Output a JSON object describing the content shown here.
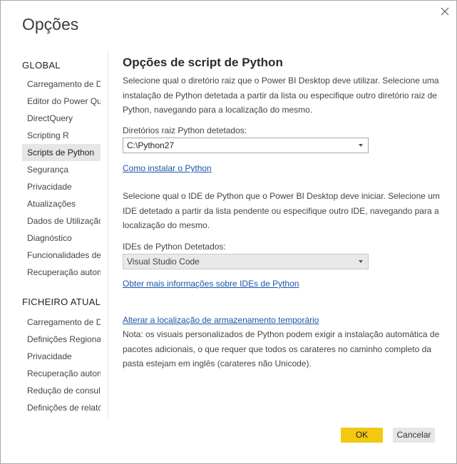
{
  "dialog": {
    "title": "Opções",
    "close_icon": "close-icon"
  },
  "sidebar": {
    "global_header": "GLOBAL",
    "global_items": [
      {
        "label": "Carregamento de Dados"
      },
      {
        "label": "Editor do Power Query"
      },
      {
        "label": "DirectQuery"
      },
      {
        "label": "Scripting R"
      },
      {
        "label": "Scripts de Python",
        "selected": true
      },
      {
        "label": "Segurança"
      },
      {
        "label": "Privacidade"
      },
      {
        "label": "Atualizações"
      },
      {
        "label": "Dados de Utilização"
      },
      {
        "label": "Diagnóstico"
      },
      {
        "label": "Funcionalidades de pré-visualização"
      },
      {
        "label": "Recuperação automática"
      }
    ],
    "file_header": "FICHEIRO ATUAL",
    "file_items": [
      {
        "label": "Carregamento de Dados"
      },
      {
        "label": "Definições Regionais"
      },
      {
        "label": "Privacidade"
      },
      {
        "label": "Recuperação automática"
      },
      {
        "label": "Redução de consultas"
      },
      {
        "label": "Definições de relatório"
      }
    ]
  },
  "main": {
    "heading": "Opções de script de Python",
    "home_dir_description": "Selecione qual o diretório raiz que o Power BI Desktop deve utilizar. Selecione uma instalação de Python detetada a partir da lista ou especifique outro diretório raiz de Python, navegando para a localização do mesmo.",
    "home_dir_label": "Diretórios raiz Python detetados:",
    "home_dir_value": "C:\\Python27",
    "install_link": "Como instalar o Python",
    "ide_description": "Selecione qual o IDE de Python que o Power BI Desktop deve iniciar. Selecione um IDE detetado a partir da lista pendente ou especifique outro IDE, navegando para a localização do mesmo.",
    "ide_label": "IDEs de Python Detetados:",
    "ide_value": "Visual Studio Code",
    "ide_info_link": "Obter mais informações sobre IDEs de Python",
    "temp_storage_link": "Alterar a localização de armazenamento temporário",
    "note": "Nota: os visuais personalizados de Python podem exigir a instalação automática de pacotes adicionais, o que requer que todos os carateres no caminho completo da pasta estejam em inglês (carateres não Unicode)."
  },
  "footer": {
    "ok_label": "OK",
    "cancel_label": "Cancelar"
  },
  "colors": {
    "accent": "#f2c811",
    "link": "#1a56a8",
    "selected_bg": "#e6e6e6"
  }
}
